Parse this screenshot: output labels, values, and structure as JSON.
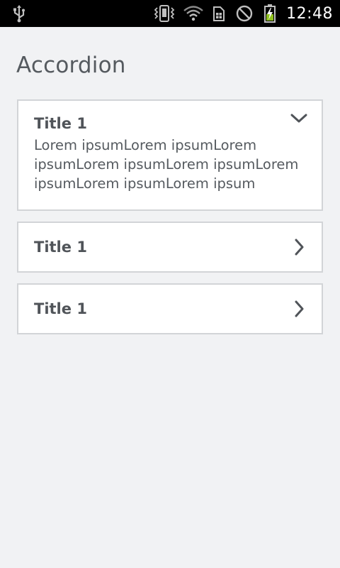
{
  "status_bar": {
    "time": "12:48",
    "icons": [
      "usb-icon",
      "vibrate-icon",
      "wifi-icon",
      "sim-icon",
      "no-signal-icon",
      "battery-charging-icon"
    ]
  },
  "page": {
    "title": "Accordion"
  },
  "accordion": {
    "items": [
      {
        "title": "Title 1",
        "state": "expanded",
        "body_lines": [
          "Lorem ipsumLorem ipsumLorem",
          "ipsumLorem ipsumLorem ipsumLorem",
          "ipsumLorem ipsumLorem ipsum"
        ],
        "icon": "chevron-down-icon"
      },
      {
        "title": "Title 1",
        "state": "collapsed",
        "icon": "chevron-right-icon"
      },
      {
        "title": "Title 1",
        "state": "collapsed",
        "icon": "chevron-right-icon"
      }
    ]
  },
  "colors": {
    "background": "#f1f2f4",
    "card": "#ffffff",
    "card_border": "#d2d4d7",
    "text": "#505459",
    "battery_accent": "#8fc11e"
  }
}
